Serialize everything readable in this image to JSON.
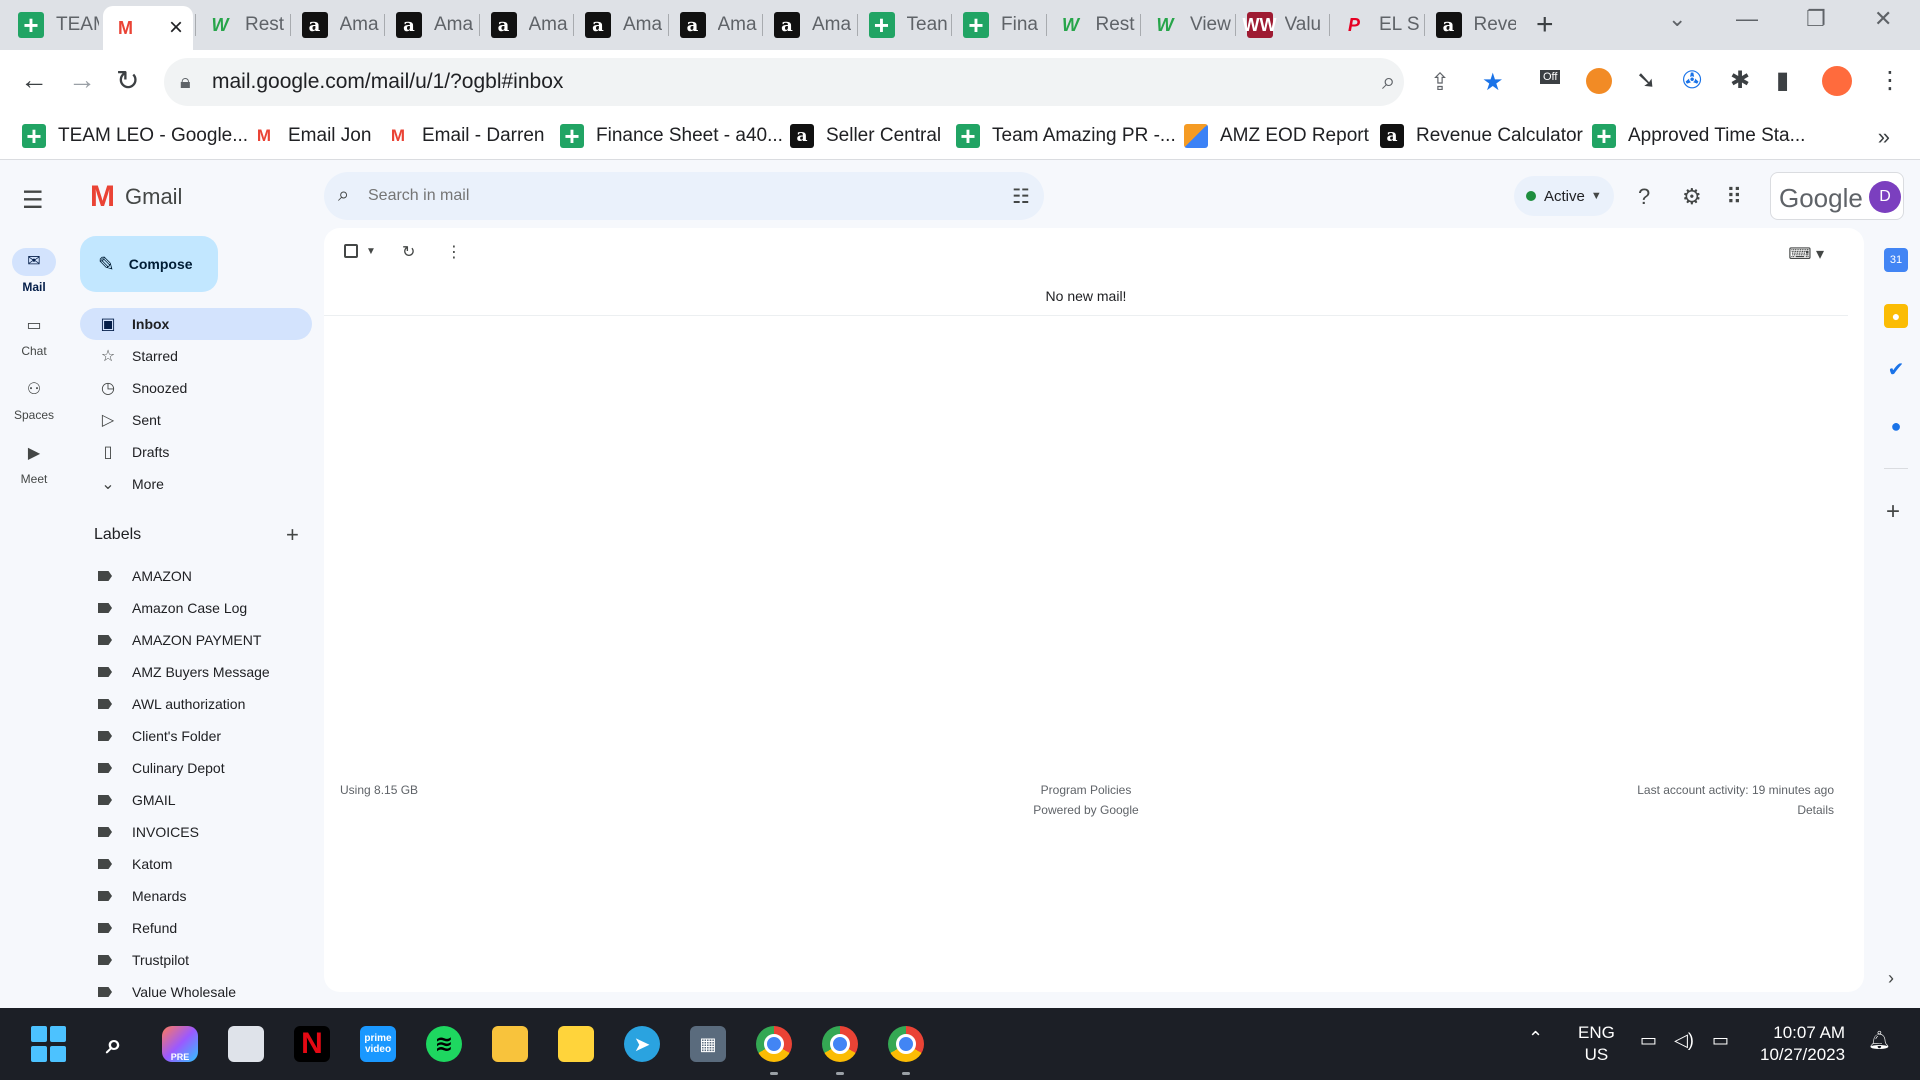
{
  "browser": {
    "tabs": [
      {
        "title": "TEAM",
        "icon": "sheets-icon",
        "active": false
      },
      {
        "title": "",
        "icon": "gmail-icon",
        "active": true
      },
      {
        "title": "Rest",
        "icon": "w-icon",
        "active": false
      },
      {
        "title": "Ama",
        "icon": "amazon-icon",
        "active": false
      },
      {
        "title": "Ama",
        "icon": "amazon-icon",
        "active": false
      },
      {
        "title": "Ama",
        "icon": "amazon-icon",
        "active": false
      },
      {
        "title": "Ama",
        "icon": "amazon-icon",
        "active": false
      },
      {
        "title": "Ama",
        "icon": "amazon-icon",
        "active": false
      },
      {
        "title": "Ama",
        "icon": "amazon-icon",
        "active": false
      },
      {
        "title": "Tean",
        "icon": "sheets-icon",
        "active": false
      },
      {
        "title": "Fina",
        "icon": "sheets-icon",
        "active": false
      },
      {
        "title": "Rest",
        "icon": "w-icon",
        "active": false
      },
      {
        "title": "View",
        "icon": "w-icon",
        "active": false
      },
      {
        "title": "Valu",
        "icon": "ww-icon",
        "active": false
      },
      {
        "title": "EL S",
        "icon": "p-icon",
        "active": false
      },
      {
        "title": "Reve",
        "icon": "amazon-icon",
        "active": false
      }
    ],
    "url": "mail.google.com/mail/u/1/?ogbl#inbox",
    "extension_off_badge": "Off",
    "bookmarks": [
      {
        "label": "TEAM LEO - Google...",
        "icon": "sheets-icon"
      },
      {
        "label": "Email Jon",
        "icon": "gmail-icon"
      },
      {
        "label": "Email - Darren",
        "icon": "gmail-icon"
      },
      {
        "label": "Finance Sheet - a40...",
        "icon": "sheets-icon"
      },
      {
        "label": "Seller Central",
        "icon": "amazon-icon"
      },
      {
        "label": "Team Amazing PR -...",
        "icon": "sheets-icon"
      },
      {
        "label": "AMZ EOD Report",
        "icon": "eod-icon"
      },
      {
        "label": "Revenue Calculator",
        "icon": "amazon-icon"
      },
      {
        "label": "Approved Time Sta...",
        "icon": "sheets-icon"
      }
    ],
    "bookmarks_more": "»"
  },
  "gmail": {
    "app_name": "Gmail",
    "rail": [
      {
        "label": "Mail",
        "icon": "mail-icon",
        "selected": true
      },
      {
        "label": "Chat",
        "icon": "chat-icon",
        "selected": false
      },
      {
        "label": "Spaces",
        "icon": "spaces-icon",
        "selected": false
      },
      {
        "label": "Meet",
        "icon": "meet-icon",
        "selected": false
      }
    ],
    "search_placeholder": "Search in mail",
    "status": "Active",
    "account": {
      "brand": "Google",
      "initial": "D"
    },
    "compose_label": "Compose",
    "nav": [
      {
        "label": "Inbox",
        "icon": "inbox-icon",
        "selected": true
      },
      {
        "label": "Starred",
        "icon": "star-icon",
        "selected": false
      },
      {
        "label": "Snoozed",
        "icon": "clock-icon",
        "selected": false
      },
      {
        "label": "Sent",
        "icon": "send-icon",
        "selected": false
      },
      {
        "label": "Drafts",
        "icon": "draft-icon",
        "selected": false
      },
      {
        "label": "More",
        "icon": "chevron-down-icon",
        "selected": false
      }
    ],
    "labels_header": "Labels",
    "labels": [
      "AMAZON",
      "Amazon Case Log",
      "AMAZON PAYMENT",
      "AMZ Buyers Message",
      "AWL authorization",
      "Client's Folder",
      "Culinary Depot",
      "GMAIL",
      "INVOICES",
      "Katom",
      "Menards",
      "Refund",
      "Trustpilot",
      "Value Wholesale"
    ],
    "main": {
      "empty_message": "No new mail!",
      "storage": "Using 8.15 GB",
      "program_policies": "Program Policies",
      "powered_by": "Powered by Google",
      "last_activity": "Last account activity: 19 minutes ago",
      "details": "Details"
    }
  },
  "taskbar": {
    "lang_line1": "ENG",
    "lang_line2": "US",
    "time": "10:07 AM",
    "date": "10/27/2023",
    "copilot_badge": "PRE",
    "prime_label": "prime video"
  },
  "colors": {
    "gmail_bg": "#f6f8fc",
    "selected_nav": "#d3e3fd",
    "compose": "#c2e7ff",
    "status_active": "#1e8e3e",
    "chrome_tabstrip": "#dee1e6",
    "taskbar": "#1c1f26"
  }
}
